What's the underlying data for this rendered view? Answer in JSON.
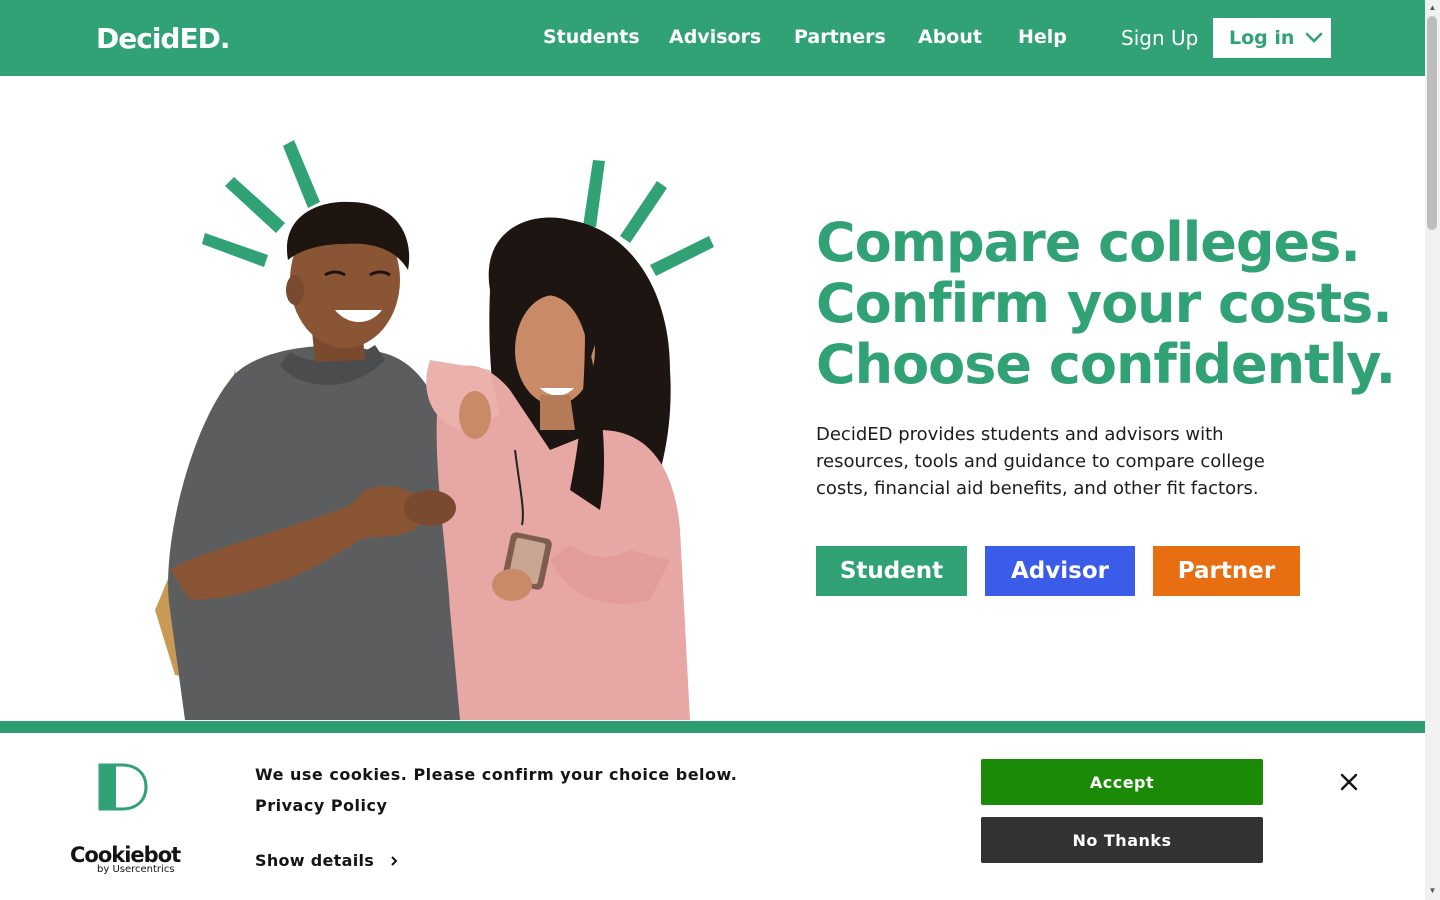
{
  "header": {
    "logo": "DecidED.",
    "nav": [
      {
        "label": "Students"
      },
      {
        "label": "Advisors"
      },
      {
        "label": "Partners"
      },
      {
        "label": "About"
      },
      {
        "label": "Help"
      }
    ],
    "signup_label": "Sign Up",
    "login_label": "Log in",
    "brand_color": "#30a275"
  },
  "hero": {
    "headline": [
      "Compare colleges.",
      "Confirm your costs.",
      "Choose confidently."
    ],
    "intro": "DecidED provides students and advisors with resources, tools and guidance to compare college costs, financial aid benefits, and other fit factors.",
    "buttons": [
      {
        "label": "Student",
        "color": "#30a275"
      },
      {
        "label": "Advisor",
        "color": "#3b5be9"
      },
      {
        "label": "Partner",
        "color": "#e86e12"
      }
    ],
    "illustration": "two-students-looking-at-phone"
  },
  "cookie_banner": {
    "message": "We use cookies. Please confirm your choice below.",
    "privacy_link": "Privacy Policy",
    "show_details": "Show details",
    "accept_label": "Accept",
    "decline_label": "No Thanks",
    "brand_name": "Cookiebot",
    "brand_sub": "by Usercentrics",
    "accept_color": "#1b8a06",
    "decline_color": "#333333"
  },
  "icons": {
    "login_dropdown": "chevron-down-icon",
    "details": "chevron-right-icon",
    "close": "close-icon",
    "cookie_logo": "decided-d-logo-icon"
  }
}
